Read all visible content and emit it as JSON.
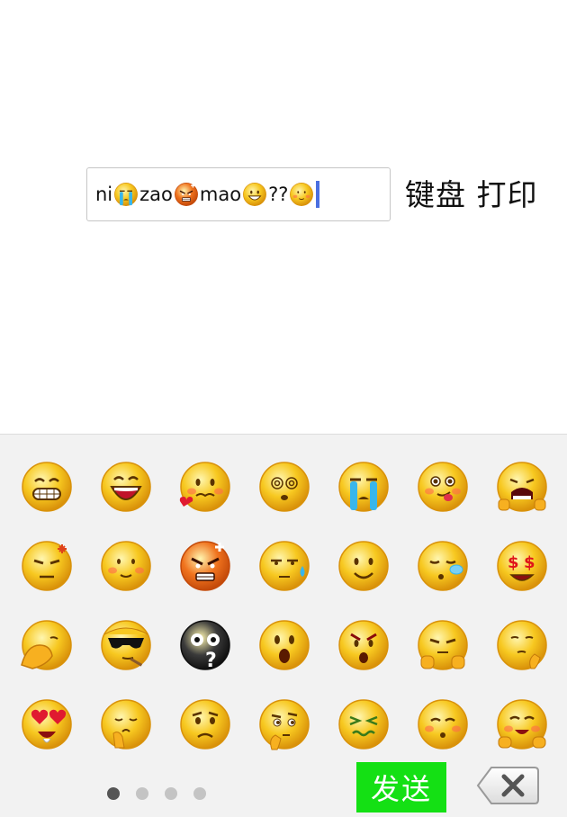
{
  "input": {
    "segments": [
      {
        "type": "text",
        "value": "ni"
      },
      {
        "type": "emoji",
        "icon": "crying-face-icon"
      },
      {
        "type": "text",
        "value": "zao"
      },
      {
        "type": "emoji",
        "icon": "angry-face-icon"
      },
      {
        "type": "text",
        "value": "mao"
      },
      {
        "type": "emoji",
        "icon": "grinning-face-icon"
      },
      {
        "type": "text",
        "value": "??"
      },
      {
        "type": "emoji",
        "icon": "smiling-face-icon"
      }
    ]
  },
  "header": {
    "keyboard_print_label": "键盘 打印"
  },
  "emoji_panel": {
    "emojis": [
      "grin-icon",
      "laugh-open-mouth-icon",
      "shy-heart-icon",
      "dizzy-face-icon",
      "loud-crying-icon",
      "tongue-out-icon",
      "scream-hands-icon",
      "annoyed-icon",
      "blush-smile-icon",
      "furious-icon",
      "sweat-icon",
      "smile-icon",
      "sleepy-snot-icon",
      "money-eyes-icon",
      "facepalm-icon",
      "sunglasses-cigar-icon",
      "dark-question-icon",
      "surprised-icon",
      "shocked-icon",
      "thumb-bite-icon",
      "shh-icon",
      "heart-eyes-icon",
      "pray-icon",
      "worried-icon",
      "thinking-icon",
      "nauseated-icon",
      "blushing-icon",
      "happy-cheeks-icon"
    ],
    "page_indicator": {
      "count": 4,
      "active": 0
    },
    "send_label": "发送",
    "delete_icon": "backspace-icon",
    "emoji_color": "#f5c518",
    "send_color": "#14e014"
  }
}
